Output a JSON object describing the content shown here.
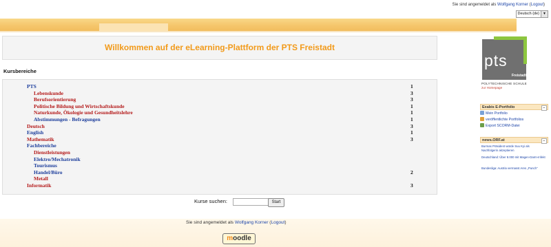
{
  "header": {
    "login_prefix": "Sie sind angemeldet als",
    "user": "Wolfgang Korner",
    "logout": "Logout",
    "language": "Deutsch (de)"
  },
  "welcome": "Willkommen auf der eLearning-Plattform der PTS Freistadt",
  "kursbereiche": {
    "heading": "Kursbereiche",
    "items": [
      {
        "label": "PTS",
        "count": "1",
        "level": 0,
        "color": "blue"
      },
      {
        "label": "Lebenskunde",
        "count": "3",
        "level": 1,
        "color": "red"
      },
      {
        "label": "Berufsorientierung",
        "count": "3",
        "level": 1,
        "color": "red"
      },
      {
        "label": "Politische Bildung und Wirtschaftskunde",
        "count": "1",
        "level": 1,
        "color": "red"
      },
      {
        "label": "Naturkunde, Ökologie und Gesundheitslehre",
        "count": "1",
        "level": 1,
        "color": "red"
      },
      {
        "label": "Abstimmungen - Befragungen",
        "count": "1",
        "level": 1,
        "color": "blue"
      },
      {
        "label": "Deutsch",
        "count": "3",
        "level": 0,
        "color": "red"
      },
      {
        "label": "English",
        "count": "1",
        "level": 0,
        "color": "blue"
      },
      {
        "label": "Mathematik",
        "count": "3",
        "level": 0,
        "color": "red"
      },
      {
        "label": "Fachbereiche",
        "count": "",
        "level": 0,
        "color": "blue"
      },
      {
        "label": "Dienstleistungen",
        "count": "",
        "level": 1,
        "color": "red"
      },
      {
        "label": "Elektro/Mechatronik",
        "count": "",
        "level": 1,
        "color": "blue"
      },
      {
        "label": "Tourismus",
        "count": "",
        "level": 1,
        "color": "blue"
      },
      {
        "label": "Handel/Büro",
        "count": "2",
        "level": 1,
        "color": "blue"
      },
      {
        "label": "Metall",
        "count": "",
        "level": 1,
        "color": "red"
      },
      {
        "label": "Informatik",
        "count": "3",
        "level": 0,
        "color": "red"
      }
    ]
  },
  "search": {
    "label": "Kurse suchen:",
    "value": "",
    "button": "Start"
  },
  "footer": {
    "login_prefix": "Sie sind angemeldet als",
    "user": "Wolfgang Korner",
    "logout": "Logout",
    "moodle": "moodle"
  },
  "sidebar": {
    "logo_text": "pts",
    "logo_sub": "Freistadt",
    "school": "POLYTECHNISCHE SCHULE",
    "homepage": "zur Homepage",
    "portfolio": {
      "title": "Exabis E-Portfolio",
      "items": [
        "Mein Portfolio",
        "veröffentlichte Portfolios",
        "Export SCORM-Datei"
      ]
    },
    "news": {
      "title": "news.ORF.at",
      "items": [
        "Burmas Präsident würde Suu Kyi als Nachfolgerin akzeptieren",
        "Deutschland: Über 8.000 mit Magen-Darm-Infekt",
        "Bundesliga: Austria vermasst Ares „Punch\""
      ]
    },
    "toggle": "−"
  }
}
